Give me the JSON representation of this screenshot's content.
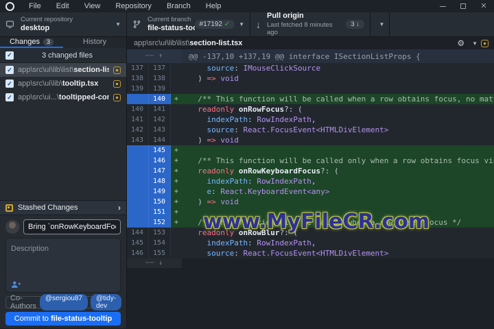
{
  "colors": {
    "accent": "#1b6ef3",
    "added_bg": "#1d4528",
    "gutter_selected": "#2b66c9",
    "modified": "#d4a72c",
    "pr_check": "#3fb950",
    "kw": "#f97583",
    "type": "#b392f0",
    "prop": "#79b8ff",
    "watermark_fill": "#2e3192",
    "watermark_glow": "#c3cc4d"
  },
  "window": {
    "menus": [
      "File",
      "Edit",
      "View",
      "Repository",
      "Branch",
      "Help"
    ]
  },
  "toolbar": {
    "repository": {
      "label": "Current repository",
      "value": "desktop"
    },
    "branch": {
      "label": "Current branch",
      "value": "file-status-too...",
      "pr_badge": "#17192",
      "pr_check": "✓"
    },
    "pull": {
      "title": "Pull origin",
      "subtitle": "Last fetched 8 minutes ago",
      "badge": "3 ↓"
    }
  },
  "sidebar": {
    "tabs": {
      "changes": "Changes",
      "changes_badge": "3",
      "history": "History"
    },
    "files_header": "3 changed files",
    "files": [
      {
        "prefix": "app\\src\\ui\\lib\\list\\",
        "name": "section-list.tsx",
        "selected": true
      },
      {
        "prefix": "app\\src\\ui\\lib\\",
        "name": "tooltip.tsx",
        "selected": false
      },
      {
        "prefix": "app\\src\\ui...\\",
        "name": "tooltipped-content.tsx",
        "selected": false
      }
    ],
    "stashed": {
      "label": "Stashed Changes",
      "chevron": "›"
    },
    "commit": {
      "summary_value": "Bring `onRowKeyboardFocus` to `Se",
      "description_placeholder": "Description",
      "coauthors_label": "Co-Authors",
      "coauthors": [
        "@sergiou87",
        "@tidy-dev"
      ],
      "button_prefix": "Commit to ",
      "button_branch": "file-status-tooltip"
    }
  },
  "diff": {
    "file_path_prefix": "app\\src\\ui\\lib\\list\\",
    "file_name": "section-list.tsx",
    "hunk_header": "@@ -137,10 +137,19 @@ interface ISectionListProps {",
    "expand_up": "┄┄ ↑",
    "expand_down": "┄┄ ↓",
    "rows": [
      {
        "o": "137",
        "n": "137",
        "a": false,
        "segs": [
          [
            "p",
            "    "
          ],
          [
            "pr",
            "source"
          ],
          [
            "p",
            ": "
          ],
          [
            "t",
            "IMouseClickSource"
          ]
        ]
      },
      {
        "o": "138",
        "n": "138",
        "a": false,
        "segs": [
          [
            "p",
            "  ) "
          ],
          [
            "k",
            "=>"
          ],
          [
            "p",
            " "
          ],
          [
            "t",
            "void"
          ]
        ]
      },
      {
        "o": "139",
        "n": "139",
        "a": false,
        "segs": []
      },
      {
        "o": "",
        "n": "140",
        "a": true,
        "segs": [
          [
            "p",
            "  "
          ],
          [
            "c",
            "/** This function will be called when a row obtains focus, no matter how */"
          ]
        ]
      },
      {
        "o": "140",
        "n": "141",
        "a": false,
        "segs": [
          [
            "p",
            "  "
          ],
          [
            "k",
            "readonly "
          ],
          [
            "b",
            "onRowFocus"
          ],
          [
            "p",
            "?: ("
          ]
        ]
      },
      {
        "o": "141",
        "n": "142",
        "a": false,
        "segs": [
          [
            "p",
            "    "
          ],
          [
            "pr",
            "indexPath"
          ],
          [
            "p",
            ": "
          ],
          [
            "t",
            "RowIndexPath"
          ],
          [
            "p",
            ","
          ]
        ]
      },
      {
        "o": "142",
        "n": "143",
        "a": false,
        "segs": [
          [
            "p",
            "    "
          ],
          [
            "pr",
            "source"
          ],
          [
            "p",
            ": "
          ],
          [
            "t",
            "React.FocusEvent<HTMLDivElement>"
          ]
        ]
      },
      {
        "o": "143",
        "n": "144",
        "a": false,
        "segs": [
          [
            "p",
            "  ) "
          ],
          [
            "k",
            "=>"
          ],
          [
            "p",
            " "
          ],
          [
            "t",
            "void"
          ]
        ]
      },
      {
        "o": "",
        "n": "145",
        "a": true,
        "segs": []
      },
      {
        "o": "",
        "n": "146",
        "a": true,
        "segs": [
          [
            "p",
            "  "
          ],
          [
            "c",
            "/** This function will be called only when a row obtains focus via keyboard */"
          ]
        ]
      },
      {
        "o": "",
        "n": "147",
        "a": true,
        "segs": [
          [
            "p",
            "  "
          ],
          [
            "k",
            "readonly "
          ],
          [
            "b",
            "onRowKeyboardFocus"
          ],
          [
            "p",
            "?: ("
          ]
        ]
      },
      {
        "o": "",
        "n": "148",
        "a": true,
        "segs": [
          [
            "p",
            "    "
          ],
          [
            "pr",
            "indexPath"
          ],
          [
            "p",
            ": "
          ],
          [
            "t",
            "RowIndexPath"
          ],
          [
            "p",
            ","
          ]
        ]
      },
      {
        "o": "",
        "n": "149",
        "a": true,
        "segs": [
          [
            "p",
            "    "
          ],
          [
            "pr",
            "e"
          ],
          [
            "p",
            ": "
          ],
          [
            "t",
            "React.KeyboardEvent<any>"
          ]
        ]
      },
      {
        "o": "",
        "n": "150",
        "a": true,
        "segs": [
          [
            "p",
            "  ) "
          ],
          [
            "k",
            "=>"
          ],
          [
            "p",
            " "
          ],
          [
            "t",
            "void"
          ]
        ]
      },
      {
        "o": "",
        "n": "151",
        "a": true,
        "segs": []
      },
      {
        "o": "",
        "n": "152",
        "a": true,
        "segs": [
          [
            "p",
            "  "
          ],
          [
            "c",
            "/** This function will be called when a row loses focus */"
          ]
        ]
      },
      {
        "o": "144",
        "n": "153",
        "a": false,
        "segs": [
          [
            "p",
            "  "
          ],
          [
            "k",
            "readonly "
          ],
          [
            "b",
            "onRowBlur"
          ],
          [
            "p",
            "?: ("
          ]
        ]
      },
      {
        "o": "145",
        "n": "154",
        "a": false,
        "segs": [
          [
            "p",
            "    "
          ],
          [
            "pr",
            "indexPath"
          ],
          [
            "p",
            ": "
          ],
          [
            "t",
            "RowIndexPath"
          ],
          [
            "p",
            ","
          ]
        ]
      },
      {
        "o": "146",
        "n": "155",
        "a": false,
        "segs": [
          [
            "p",
            "    "
          ],
          [
            "pr",
            "source"
          ],
          [
            "p",
            ": "
          ],
          [
            "t",
            "React.FocusEvent<HTMLDivElement>"
          ]
        ]
      }
    ]
  },
  "watermark": "www.MyFileCR.com"
}
